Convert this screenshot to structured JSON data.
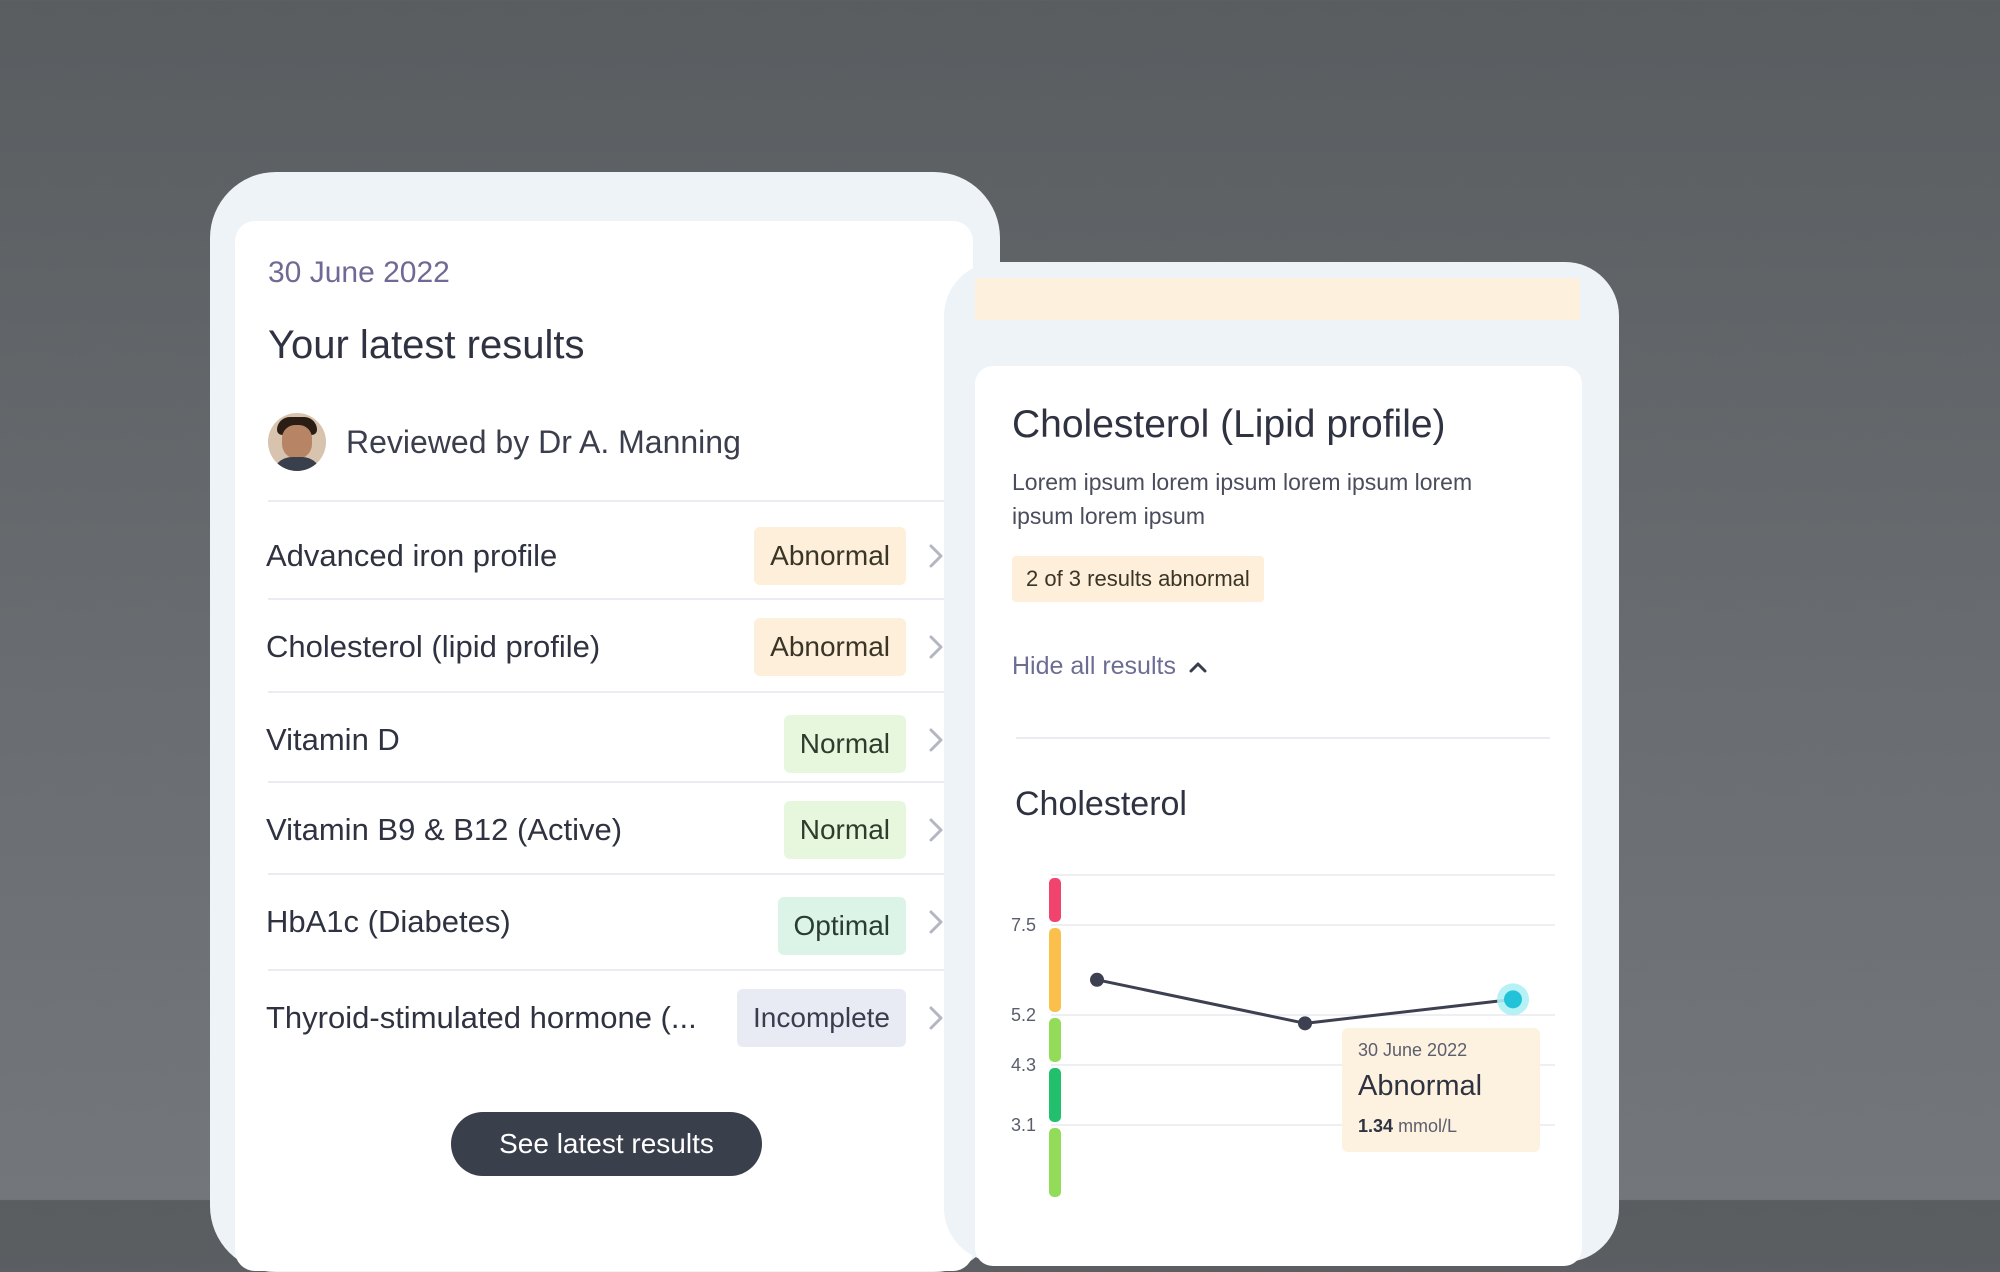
{
  "results_card": {
    "date": "30 June 2022",
    "title": "Your latest results",
    "reviewer": "Reviewed by Dr A. Manning",
    "items": [
      {
        "label": "Advanced iron profile",
        "status": "Abnormal"
      },
      {
        "label": "Cholesterol (lipid profile)",
        "status": "Abnormal"
      },
      {
        "label": "Vitamin D",
        "status": "Normal"
      },
      {
        "label": "Vitamin B9 & B12 (Active)",
        "status": "Normal"
      },
      {
        "label": "HbA1c (Diabetes)",
        "status": "Optimal"
      },
      {
        "label": "Thyroid-stimulated hormone (...",
        "status": "Incomplete"
      }
    ],
    "cta": "See latest results"
  },
  "detail_card": {
    "title": "Cholesterol (Lipid profile)",
    "description": "Lorem ipsum lorem ipsum lorem ipsum lorem ipsum lorem ipsum",
    "summary": "2 of 3 results abnormal",
    "toggle": "Hide all results",
    "chart_title": "Cholesterol",
    "tooltip": {
      "date": "30 June 2022",
      "status": "Abnormal",
      "value": "1.34",
      "unit": "mmol/L"
    }
  },
  "chart_data": {
    "type": "line",
    "title": "Cholesterol",
    "y_ticks": [
      7.5,
      5.2,
      4.3,
      3.1
    ],
    "series": [
      {
        "values": [
          6.1,
          5.05,
          5.6
        ]
      }
    ],
    "highlighted_point": 2,
    "range_colors": {
      "very_high": "#f0436d",
      "high": "#fbc04b",
      "borderline": "#92dc5a",
      "optimal": "#22c06c",
      "low": "#92dc5a"
    },
    "grid": true
  },
  "colors": {
    "abnormal_bg": "#fdefd9",
    "normal_bg": "#e6f7de",
    "optimal_bg": "#dcf3e7",
    "incomplete_bg": "#e9ebf4",
    "cta_bg": "#3a3f4c",
    "highlight": "#22c3d8"
  }
}
